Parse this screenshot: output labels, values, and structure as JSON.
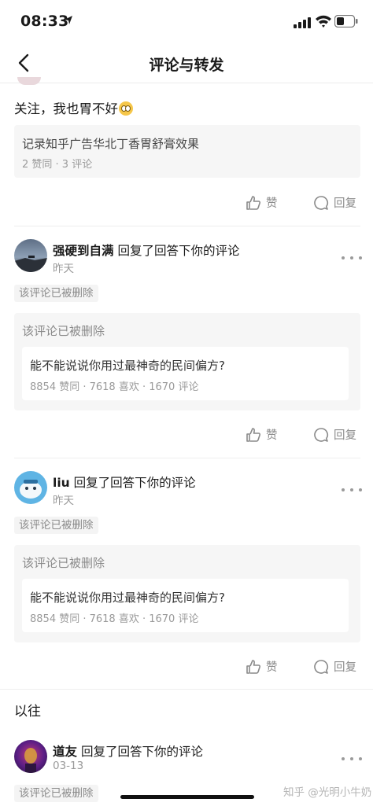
{
  "status_bar": {
    "time": "08:33"
  },
  "nav": {
    "title": "评论与转发"
  },
  "first_item": {
    "comment": "关注，我也胃不好",
    "quote_title": "记录知乎广告华北丁香胃舒膏效果",
    "quote_meta": "2 赞同 · 3 评论"
  },
  "actions": {
    "like": "赞",
    "reply": "回复"
  },
  "notifications": [
    {
      "user": "强硬到自满",
      "action": "回复了回答下你的评论",
      "time": "昨天",
      "deleted_tag": "该评论已被删除",
      "quote_deleted": "该评论已被删除",
      "question": "能不能说说你用过最神奇的民间偏方?",
      "question_meta": "8854 赞同 · 7618 喜欢 · 1670 评论"
    },
    {
      "user": "liu",
      "action": "回复了回答下你的评论",
      "time": "昨天",
      "deleted_tag": "该评论已被删除",
      "quote_deleted": "该评论已被删除",
      "question": "能不能说说你用过最神奇的民间偏方?",
      "question_meta": "8854 赞同 · 7618 喜欢 · 1670 评论"
    },
    {
      "user": "道友",
      "action": "回复了回答下你的评论",
      "time": "03-13",
      "deleted_tag": "该评论已被删除"
    }
  ],
  "section": {
    "previous": "以往"
  },
  "watermark": "知乎 @光明小牛奶",
  "colors": {
    "text": "#1a1a1a",
    "secondary": "#9a9a9a",
    "card_bg": "#f6f6f6",
    "divider": "#eeeeee"
  },
  "icons": [
    "location-arrow-icon",
    "signal-icon",
    "wifi-icon",
    "battery-icon",
    "back-chevron-icon",
    "thumbs-up-icon",
    "reply-bubble-icon",
    "more-dots-icon"
  ]
}
